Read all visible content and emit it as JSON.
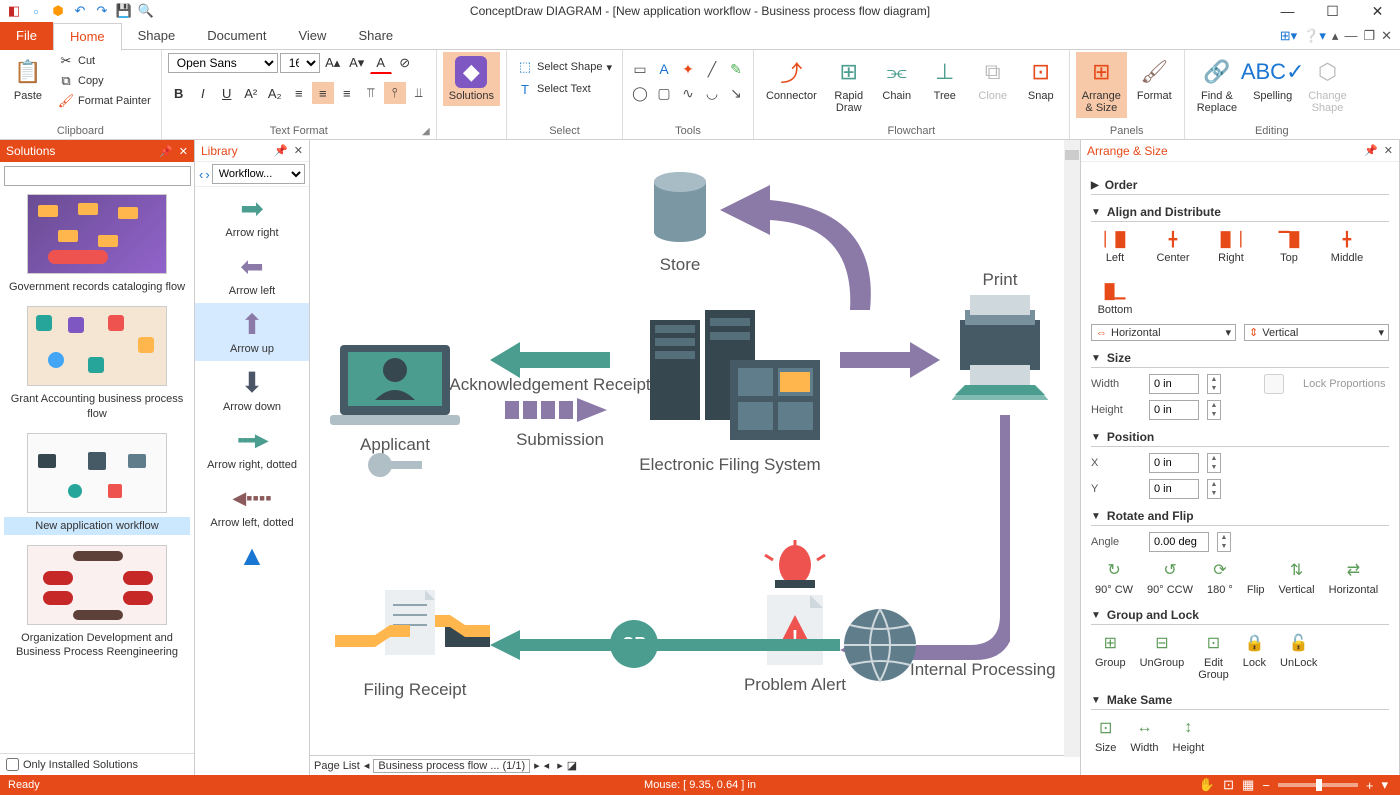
{
  "app_title": "ConceptDraw DIAGRAM - [New application workflow - Business process flow diagram]",
  "menu": {
    "file": "File",
    "tabs": [
      "Home",
      "Shape",
      "Document",
      "View",
      "Share"
    ],
    "active": 0
  },
  "ribbon": {
    "clipboard": {
      "paste": "Paste",
      "cut": "Cut",
      "copy": "Copy",
      "format_painter": "Format Painter",
      "label": "Clipboard"
    },
    "text_format": {
      "font": "Open Sans",
      "size": "16",
      "label": "Text Format"
    },
    "solutions": {
      "btn": "Solutions"
    },
    "select": {
      "select_shape": "Select Shape",
      "select_text": "Select Text",
      "label": "Select"
    },
    "tools": {
      "label": "Tools"
    },
    "flowchart": {
      "connector": "Connector",
      "rapid_draw": "Rapid\nDraw",
      "chain": "Chain",
      "tree": "Tree",
      "clone": "Clone",
      "snap": "Snap",
      "label": "Flowchart"
    },
    "panels": {
      "arrange_size": "Arrange\n& Size",
      "format": "Format",
      "label": "Panels"
    },
    "editing": {
      "find_replace": "Find &\nReplace",
      "spelling": "Spelling",
      "change_shape": "Change\nShape",
      "label": "Editing"
    }
  },
  "solutions_panel": {
    "title": "Solutions",
    "items": [
      {
        "label": "Government records cataloging flow",
        "selected": false
      },
      {
        "label": "Grant Accounting business process flow",
        "selected": false
      },
      {
        "label": "New application workflow",
        "selected": true
      },
      {
        "label": "Organization Development and Business Process Reengineering",
        "selected": false
      }
    ],
    "only_installed": "Only Installed Solutions"
  },
  "library_panel": {
    "title": "Library",
    "dropdown": "Workflow...",
    "items": [
      {
        "label": "Arrow right"
      },
      {
        "label": "Arrow left"
      },
      {
        "label": "Arrow up",
        "selected": true
      },
      {
        "label": "Arrow down"
      },
      {
        "label": "Arrow right, dotted"
      },
      {
        "label": "Arrow left, dotted"
      }
    ]
  },
  "canvas": {
    "labels": {
      "store": "Store",
      "print": "Print",
      "applicant": "Applicant",
      "ack": "Acknowledgement Receipt",
      "submission": "Submission",
      "efs": "Electronic Filing System",
      "or": "OR",
      "filing_receipt": "Filing Receipt",
      "problem_alert": "Problem Alert",
      "internal": "Internal Processing"
    },
    "page_list": "Page List",
    "page_tab": "Business process flow ...  (1/1)"
  },
  "arrange_panel": {
    "title": "Arrange & Size",
    "sections": {
      "order": "Order",
      "align": "Align and Distribute",
      "size": "Size",
      "position": "Position",
      "rotate": "Rotate and Flip",
      "group": "Group and Lock",
      "make_same": "Make Same"
    },
    "align": {
      "left": "Left",
      "center": "Center",
      "right": "Right",
      "top": "Top",
      "middle": "Middle",
      "bottom": "Bottom"
    },
    "distribute": {
      "horizontal": "Horizontal",
      "vertical": "Vertical"
    },
    "size": {
      "width": "Width",
      "height": "Height",
      "width_val": "0 in",
      "height_val": "0 in",
      "lock": "Lock Proportions"
    },
    "position": {
      "x": "X",
      "y": "Y",
      "x_val": "0 in",
      "y_val": "0 in"
    },
    "rotate": {
      "angle": "Angle",
      "angle_val": "0.00 deg",
      "cw": "90° CW",
      "ccw": "90° CCW",
      "r180": "180 °",
      "flip": "Flip",
      "vertical": "Vertical",
      "horizontal": "Horizontal"
    },
    "group": {
      "group": "Group",
      "ungroup": "UnGroup",
      "edit_group": "Edit\nGroup",
      "lock": "Lock",
      "unlock": "UnLock"
    },
    "make_same": {
      "size": "Size",
      "width": "Width",
      "height": "Height"
    }
  },
  "status": {
    "ready": "Ready",
    "mouse": "Mouse: [ 9.35, 0.64 ] in"
  }
}
